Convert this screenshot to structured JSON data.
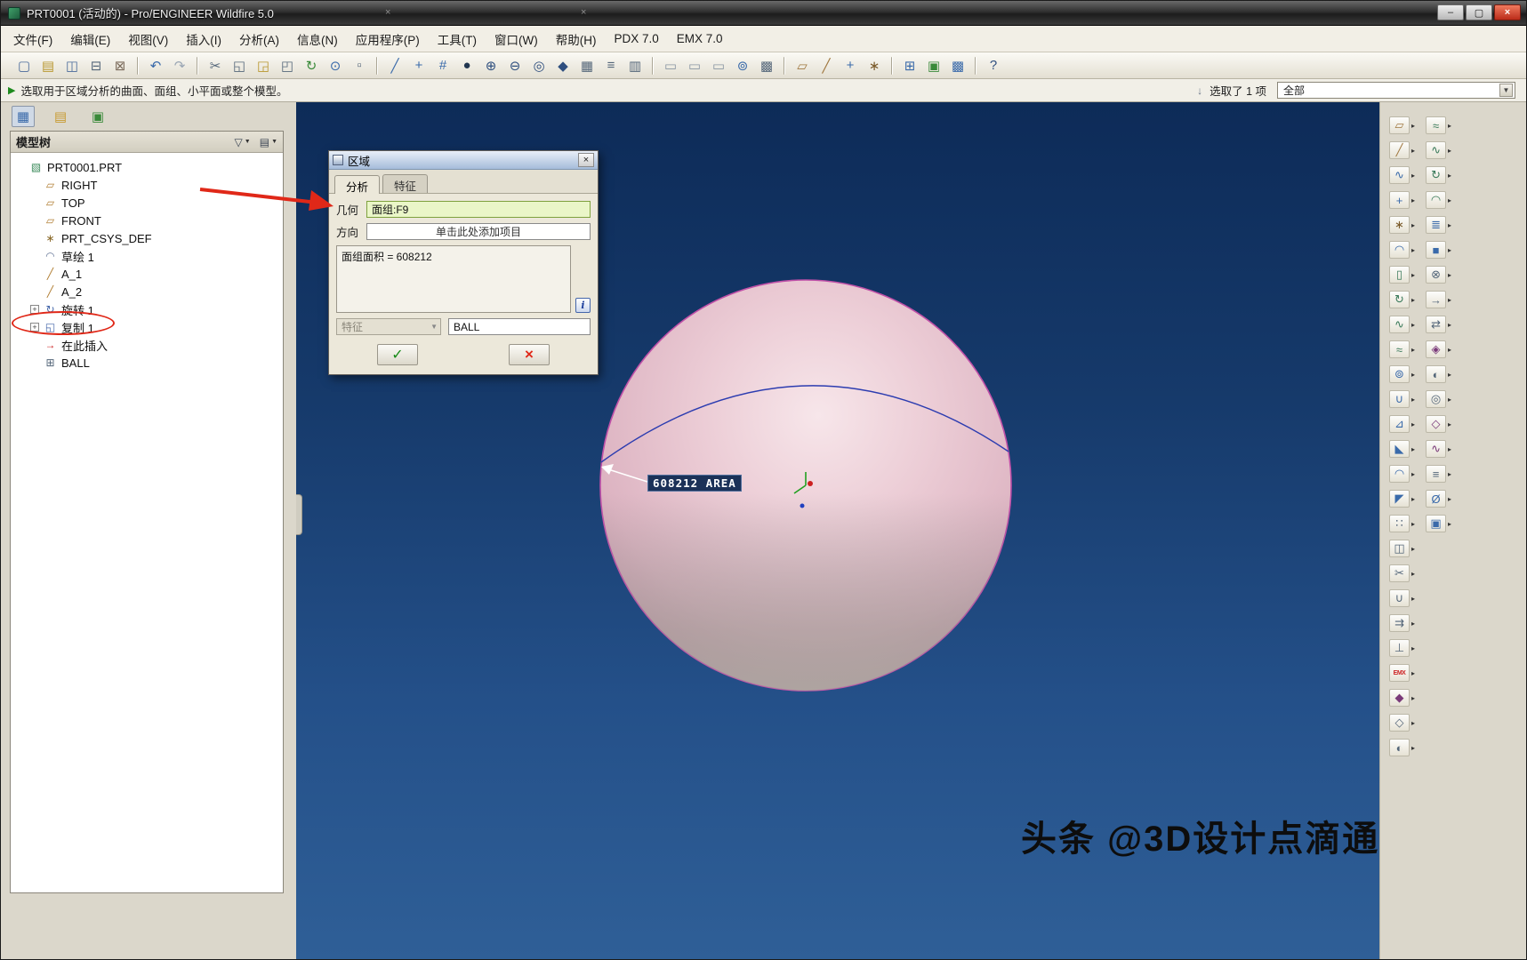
{
  "colors": {
    "annotation_red": "#e02818",
    "highlight_green": "#eaf6c8",
    "viewport_blue": "#163a6b",
    "sphere_pink": "#ecccd6",
    "area_label_navy": "#1b3158"
  },
  "window": {
    "title": "PRT0001 (活动的) - Pro/ENGINEER Wildfire 5.0",
    "controls": {
      "minimize": "–",
      "maximize": "▢",
      "close": "×"
    },
    "ghost_close": "×"
  },
  "menu_bar": {
    "items": [
      {
        "name": "menu-file",
        "label": "文件(F)"
      },
      {
        "name": "menu-edit",
        "label": "编辑(E)"
      },
      {
        "name": "menu-view",
        "label": "视图(V)"
      },
      {
        "name": "menu-insert",
        "label": "插入(I)"
      },
      {
        "name": "menu-analysis",
        "label": "分析(A)"
      },
      {
        "name": "menu-info",
        "label": "信息(N)"
      },
      {
        "name": "menu-applications",
        "label": "应用程序(P)"
      },
      {
        "name": "menu-tools",
        "label": "工具(T)"
      },
      {
        "name": "menu-window",
        "label": "窗口(W)"
      },
      {
        "name": "menu-help",
        "label": "帮助(H)"
      },
      {
        "name": "menu-pdx",
        "label": "PDX 7.0"
      },
      {
        "name": "menu-emx",
        "label": "EMX 7.0"
      }
    ]
  },
  "toolbar": {
    "items": [
      {
        "name": "new-file-icon",
        "glyph": "▢",
        "color": "#4a6a9a"
      },
      {
        "name": "open-file-icon",
        "glyph": "▤",
        "color": "#b8962e"
      },
      {
        "name": "save-icon",
        "glyph": "◫",
        "color": "#4a6a9a"
      },
      {
        "name": "print-icon",
        "glyph": "⊟",
        "color": "#55677a"
      },
      {
        "name": "erase-display-icon",
        "glyph": "⊠",
        "color": "#7a6a5a"
      },
      {
        "name": "toolbar-separator",
        "cls": "sep",
        "inter": "false"
      },
      {
        "name": "undo-icon",
        "glyph": "↶",
        "color": "#3a6aaa"
      },
      {
        "name": "redo-icon",
        "glyph": "↷",
        "color": "#9aa6b4"
      },
      {
        "name": "toolbar-separator",
        "cls": "sep",
        "inter": "false"
      },
      {
        "name": "cut-icon",
        "glyph": "✂",
        "color": "#55677a"
      },
      {
        "name": "copy-icon",
        "glyph": "◱",
        "color": "#55677a"
      },
      {
        "name": "paste-icon",
        "glyph": "◲",
        "color": "#b8962e"
      },
      {
        "name": "paste-special-icon",
        "glyph": "◰",
        "color": "#55677a"
      },
      {
        "name": "regenerate-icon",
        "glyph": "↻",
        "color": "#3a8a3a"
      },
      {
        "name": "search-icon",
        "glyph": "⊙",
        "color": "#3a6aaa"
      },
      {
        "name": "select-box-icon",
        "glyph": "▫",
        "color": "#55677a"
      },
      {
        "name": "toolbar-separator",
        "cls": "sep",
        "inter": "false"
      },
      {
        "name": "line-tool-icon",
        "glyph": "╱",
        "color": "#3a6aaa"
      },
      {
        "name": "point-tool-icon",
        "glyph": "+",
        "color": "#3a6aaa"
      },
      {
        "name": "snap-grid-icon",
        "glyph": "#",
        "color": "#3a6aaa"
      },
      {
        "name": "shaded-view-icon",
        "glyph": "●",
        "color": "#223650"
      },
      {
        "name": "zoom-in-icon",
        "glyph": "⊕",
        "color": "#2f4f7f"
      },
      {
        "name": "zoom-out-icon",
        "glyph": "⊖",
        "color": "#2f4f7f"
      },
      {
        "name": "refit-icon",
        "glyph": "◎",
        "color": "#2f4f7f"
      },
      {
        "name": "repaint-icon",
        "glyph": "◆",
        "color": "#2f4f7f"
      },
      {
        "name": "saved-views-icon",
        "glyph": "▦",
        "color": "#55677a"
      },
      {
        "name": "layers-icon",
        "glyph": "≡",
        "color": "#55677a"
      },
      {
        "name": "view-manager-icon",
        "glyph": "▥",
        "color": "#55677a"
      },
      {
        "name": "toolbar-separator",
        "cls": "sep",
        "inter": "false"
      },
      {
        "name": "window-new-icon",
        "glyph": "▭",
        "color": "#8a96a4"
      },
      {
        "name": "window-tile-icon",
        "glyph": "▭",
        "color": "#8a96a4"
      },
      {
        "name": "window-activate-icon",
        "glyph": "▭",
        "color": "#8a96a4"
      },
      {
        "name": "annotation-icon",
        "glyph": "⊚",
        "color": "#3a6aaa"
      },
      {
        "name": "grid-display-icon",
        "glyph": "▩",
        "color": "#55677a"
      },
      {
        "name": "toolbar-separator",
        "cls": "sep",
        "inter": "false"
      },
      {
        "name": "datum-plane-toggle-icon",
        "glyph": "▱",
        "color": "#a07840"
      },
      {
        "name": "datum-axis-toggle-icon",
        "glyph": "╱",
        "color": "#a07840"
      },
      {
        "name": "datum-point-toggle-icon",
        "glyph": "+",
        "color": "#3a6aaa"
      },
      {
        "name": "csys-toggle-icon",
        "glyph": "∗",
        "color": "#7a5a2a"
      },
      {
        "name": "toolbar-separator",
        "cls": "sep",
        "inter": "false"
      },
      {
        "name": "model-tree-toggle-icon",
        "glyph": "⊞",
        "color": "#3a6aaa"
      },
      {
        "name": "info-panel-toggle-icon",
        "glyph": "▣",
        "color": "#3a8a3a"
      },
      {
        "name": "browser-toggle-icon",
        "glyph": "▩",
        "color": "#3a6aaa"
      },
      {
        "name": "toolbar-separator",
        "cls": "sep",
        "inter": "false"
      },
      {
        "name": "context-help-icon",
        "glyph": "?",
        "color": "#2f4f7f"
      }
    ]
  },
  "message_bar": {
    "prompt_icon": "▶",
    "message": "选取用于区域分析的曲面、面组、小平面或整个模型。",
    "selector_icon": "↓",
    "selected_count": "选取了 1 项",
    "filter_value": "全部",
    "caret": "▼"
  },
  "left_panel": {
    "tabs": [
      {
        "name": "model-tree-tab-icon",
        "glyph": "▦",
        "color": "#3a6aaa",
        "cls": "active"
      },
      {
        "name": "folder-browser-tab-icon",
        "glyph": "▤",
        "color": "#c89a30"
      },
      {
        "name": "favorites-tab-icon",
        "glyph": "▣",
        "color": "#3a8a3a"
      }
    ]
  },
  "model_tree": {
    "title": "模型树",
    "header_buttons": [
      {
        "name": "tree-filter-button",
        "glyph": "▽",
        "caret": "▼"
      },
      {
        "name": "tree-display-button",
        "glyph": "▤",
        "caret": "▼"
      }
    ],
    "items": [
      {
        "name": "tree-item-prt0001",
        "label": "PRT0001.PRT",
        "glyph": "▧",
        "color": "#3a8a5a",
        "level": 0
      },
      {
        "name": "tree-item-right",
        "label": "RIGHT",
        "glyph": "▱",
        "color": "#b07c30",
        "level": 1
      },
      {
        "name": "tree-item-top",
        "label": "TOP",
        "glyph": "▱",
        "color": "#b07c30",
        "level": 1
      },
      {
        "name": "tree-item-front",
        "label": "FRONT",
        "glyph": "▱",
        "color": "#b07c30",
        "level": 1
      },
      {
        "name": "tree-item-prt-csys-def",
        "label": "PRT_CSYS_DEF",
        "glyph": "∗",
        "color": "#8a6a2a",
        "level": 1
      },
      {
        "name": "tree-item-sketch-1",
        "label": "草绘 1",
        "glyph": "◠",
        "color": "#6a7a9a",
        "level": 1
      },
      {
        "name": "tree-item-a1",
        "label": "A_1",
        "glyph": "╱",
        "color": "#b07c30",
        "level": 1
      },
      {
        "name": "tree-item-a2",
        "label": "A_2",
        "glyph": "╱",
        "color": "#b07c30",
        "level": 1
      },
      {
        "name": "tree-item-revolve-1",
        "label": "旋转 1",
        "glyph": "↻",
        "color": "#4466aa",
        "level": 1,
        "expander": "+"
      },
      {
        "name": "tree-item-copy-1",
        "label": "复制 1",
        "glyph": "◱",
        "color": "#4466aa",
        "level": 1,
        "expander": "+"
      },
      {
        "name": "tree-item-insert-here",
        "label": "在此插入",
        "glyph": "→",
        "color": "#cc2222",
        "level": 1
      },
      {
        "name": "tree-item-ball",
        "label": "BALL",
        "glyph": "⊞",
        "color": "#55677a",
        "level": 1
      }
    ]
  },
  "viewport": {
    "area_label": "608212 AREA",
    "watermark": "头条 @3D设计点滴通"
  },
  "dialog": {
    "title": "区域",
    "close_glyph": "×",
    "tabs": [
      {
        "name": "tab-analysis",
        "label": "分析"
      },
      {
        "name": "tab-feature",
        "label": "特征"
      }
    ],
    "geometry_label": "几何",
    "geometry_value": "面组:F9",
    "direction_label": "方向",
    "direction_value": "单击此处添加项目",
    "result_text": "面组面积 = 608212",
    "info_glyph": "i",
    "feature_dropdown_label": "特征",
    "dropdown_caret": "▼",
    "name_value": "BALL",
    "ok_glyph": "✓",
    "cancel_glyph": "×"
  },
  "right_toolbar": {
    "flyout_glyph": "▸",
    "col1": [
      {
        "name": "datum-plane-tool-icon",
        "glyph": "▱",
        "color": "#a07840"
      },
      {
        "name": "datum-axis-tool-icon",
        "glyph": "╱",
        "color": "#a07840"
      },
      {
        "name": "datum-curve-tool-icon",
        "glyph": "∿",
        "color": "#3a6aaa"
      },
      {
        "name": "datum-point-tool-icon",
        "glyph": "+",
        "color": "#3a6aaa"
      },
      {
        "name": "coordinate-system-tool-icon",
        "glyph": "∗",
        "color": "#7a5a2a"
      },
      {
        "name": "sketch-tool-icon",
        "glyph": "◠",
        "color": "#3a6aaa"
      },
      {
        "name": "extrude-tool-icon",
        "glyph": "▯",
        "color": "#3a7a5a"
      },
      {
        "name": "revolve-tool-icon",
        "glyph": "↻",
        "color": "#3a7a5a"
      },
      {
        "name": "sweep-tool-icon",
        "glyph": "∿",
        "color": "#3a7a5a"
      },
      {
        "name": "blend-tool-icon",
        "glyph": "≈",
        "color": "#3a7a5a"
      },
      {
        "name": "hole-tool-icon",
        "glyph": "⊚",
        "color": "#3a6aaa"
      },
      {
        "name": "shell-tool-icon",
        "glyph": "∪",
        "color": "#3a6aaa"
      },
      {
        "name": "rib-tool-icon",
        "glyph": "⊿",
        "color": "#3a6aaa"
      },
      {
        "name": "draft-tool-icon",
        "glyph": "◣",
        "color": "#3a6aaa"
      },
      {
        "name": "round-tool-icon",
        "glyph": "◠",
        "color": "#3a6aaa"
      },
      {
        "name": "chamfer-tool-icon",
        "glyph": "◤",
        "color": "#3a6aaa"
      },
      {
        "name": "pattern-tool-icon",
        "glyph": "∷",
        "color": "#55677a"
      },
      {
        "name": "mirror-tool-icon",
        "glyph": "◫",
        "color": "#55677a"
      },
      {
        "name": "trim-tool-icon",
        "glyph": "✂",
        "color": "#55677a"
      },
      {
        "name": "merge-tool-icon",
        "glyph": "∪",
        "color": "#55677a"
      },
      {
        "name": "offset-tool-icon",
        "glyph": "⇉",
        "color": "#55677a"
      },
      {
        "name": "project-tool-icon",
        "glyph": "⊥",
        "color": "#55677a"
      },
      {
        "name": "emx-tool-icon",
        "glyph": "EMX",
        "color": "#cc2222",
        "cls": "emx"
      },
      {
        "name": "style-tool-icon",
        "glyph": "◆",
        "color": "#7a3a7a"
      },
      {
        "name": "wireframe-tool-icon",
        "glyph": "◇",
        "color": "#55677a"
      },
      {
        "name": "surface-tool-icon",
        "glyph": "◐",
        "color": "#55677a"
      }
    ],
    "col2": [
      {
        "name": "boundary-blend-tool-icon",
        "glyph": "≈",
        "color": "#3a7a5a"
      },
      {
        "name": "variable-sweep-tool-icon",
        "glyph": "∿",
        "color": "#3a7a5a"
      },
      {
        "name": "helical-sweep-tool-icon",
        "glyph": "↻",
        "color": "#3a7a5a"
      },
      {
        "name": "swept-blend-tool-icon",
        "glyph": "◠",
        "color": "#3a7a5a"
      },
      {
        "name": "thicken-tool-icon",
        "glyph": "≣",
        "color": "#3a6aaa"
      },
      {
        "name": "solidify-tool-icon",
        "glyph": "■",
        "color": "#3a6aaa"
      },
      {
        "name": "intersect-tool-icon",
        "glyph": "⊗",
        "color": "#55677a"
      },
      {
        "name": "extend-tool-icon",
        "glyph": "→",
        "color": "#55677a"
      },
      {
        "name": "move-tool-icon",
        "glyph": "⇄",
        "color": "#55677a"
      },
      {
        "name": "flexible-modeling-tool-icon",
        "glyph": "◈",
        "color": "#7a3a7a"
      },
      {
        "name": "wrap-tool-icon",
        "glyph": "◐",
        "color": "#55677a"
      },
      {
        "name": "toroid-tool-icon",
        "glyph": "◎",
        "color": "#55677a"
      },
      {
        "name": "freestyle-tool-icon",
        "glyph": "◇",
        "color": "#7a3a7a"
      },
      {
        "name": "warp-tool-icon",
        "glyph": "∿",
        "color": "#7a3a7a"
      },
      {
        "name": "annotate-tool-icon",
        "glyph": "≡",
        "color": "#55677a"
      },
      {
        "name": "measure-tool-icon",
        "glyph": "Ø",
        "color": "#3a6aaa"
      },
      {
        "name": "component-tool-icon",
        "glyph": "▣",
        "color": "#3a6aaa"
      }
    ]
  }
}
